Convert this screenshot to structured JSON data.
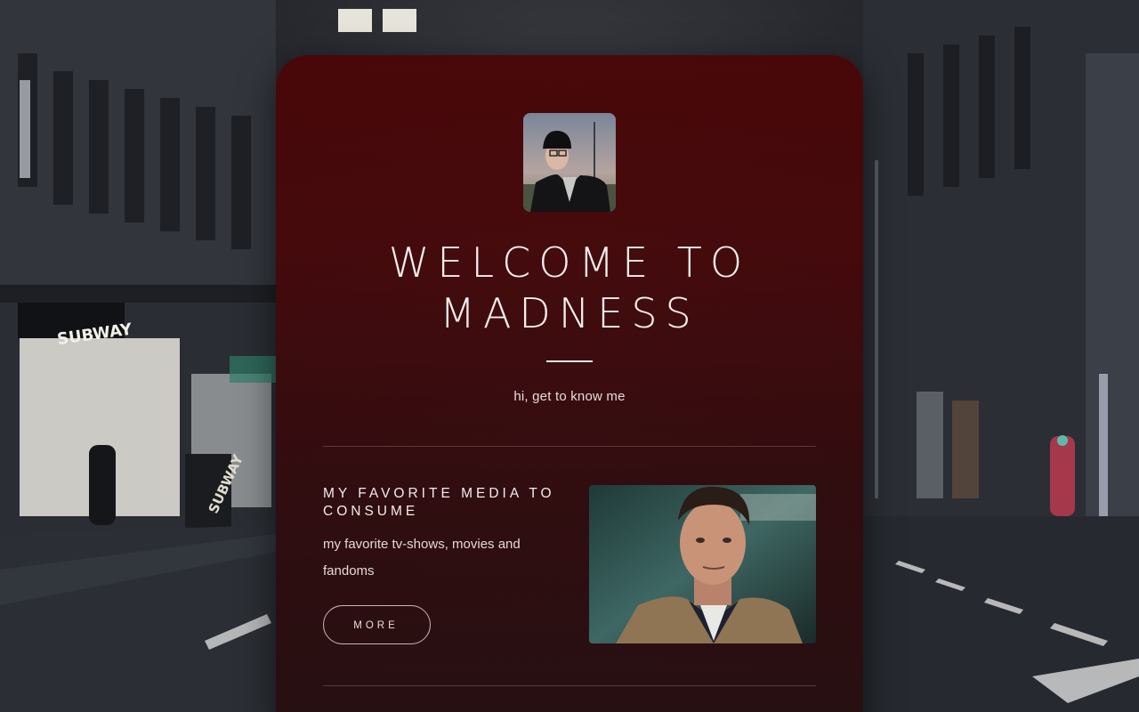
{
  "hero": {
    "title": "WELCOME TO MADNESS",
    "subtitle": "hi, get to know me",
    "avatar_alt": "profile photo"
  },
  "sections": [
    {
      "heading": "MY FAVORITE MEDIA TO CONSUME",
      "text": "my favorite tv-shows, movies and fandoms",
      "button_label": "MORE",
      "image_alt": "TV show still"
    }
  ],
  "background": {
    "scene": "night city street",
    "storefront_signs": [
      "SUBWAY",
      "SUBWAY"
    ]
  },
  "colors": {
    "card": "#4a0608",
    "text": "#f4eeee",
    "page_background": "#1b1d22"
  }
}
